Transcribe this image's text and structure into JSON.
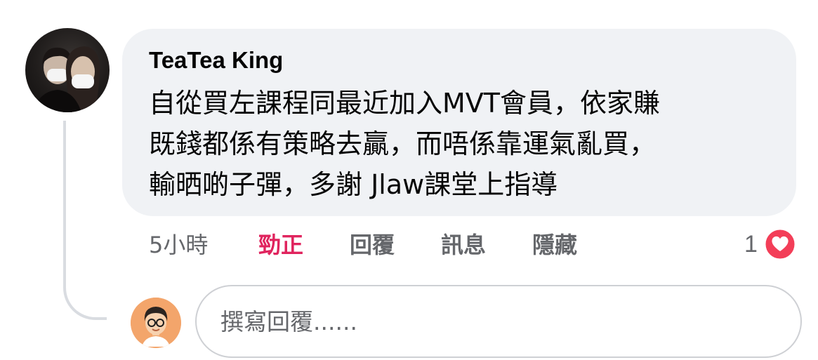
{
  "comment": {
    "author": "TeaTea King",
    "lines": [
      "自從買左課程同最近加入MVT會員，依家賺",
      "既錢都係有策略去贏，而唔係靠運氣亂買，",
      "輸晒啲子彈，多謝 Jlaw課堂上指導"
    ],
    "avatar_icon": "user-photo-avatar"
  },
  "actions": {
    "time": "5小時",
    "like_label": "勁正",
    "reply_label": "回覆",
    "message_label": "訊息",
    "hide_label": "隱藏"
  },
  "reactions": {
    "count": "1",
    "icon": "heart-icon",
    "color": "#f33e58"
  },
  "reply": {
    "placeholder": "撰寫回覆......",
    "value": "",
    "avatar_icon": "cartoon-user-avatar"
  },
  "colors": {
    "bubble": "#f0f2f5",
    "text": "#050505",
    "secondary": "#65676b",
    "like_active": "#e0245e"
  }
}
